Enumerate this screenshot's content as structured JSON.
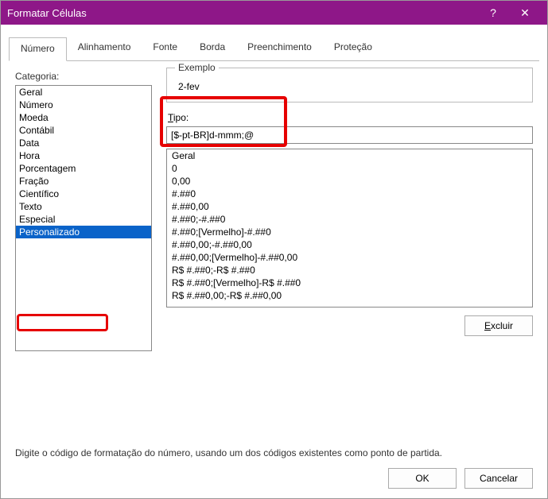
{
  "titlebar": {
    "title": "Formatar Células",
    "help": "?",
    "close": "✕"
  },
  "tabs": {
    "numero": "Número",
    "alinhamento": "Alinhamento",
    "fonte": "Fonte",
    "borda": "Borda",
    "preenchimento": "Preenchimento",
    "protecao": "Proteção"
  },
  "labels": {
    "categoria": "Categoria:",
    "exemplo": "Exemplo",
    "tipo_prefix": "T",
    "tipo_rest": "ipo:",
    "hint": "Digite o código de formatação do número, usando um dos códigos existentes como ponto de partida."
  },
  "example_value": "2-fev",
  "type_value": "[$-pt-BR]d-mmm;@",
  "categories": [
    "Geral",
    "Número",
    "Moeda",
    "Contábil",
    "Data",
    "Hora",
    "Porcentagem",
    "Fração",
    "Científico",
    "Texto",
    "Especial",
    "Personalizado"
  ],
  "selected_category_index": 11,
  "format_codes": [
    "Geral",
    "0",
    "0,00",
    "#.##0",
    "#.##0,00",
    "#.##0;-#.##0",
    "#.##0;[Vermelho]-#.##0",
    "#.##0,00;-#.##0,00",
    "#.##0,00;[Vermelho]-#.##0,00",
    "R$ #.##0;-R$ #.##0",
    "R$ #.##0;[Vermelho]-R$ #.##0",
    "R$ #.##0,00;-R$ #.##0,00"
  ],
  "buttons": {
    "excluir_prefix": "E",
    "excluir_rest": "xcluir",
    "ok": "OK",
    "cancelar": "Cancelar"
  }
}
